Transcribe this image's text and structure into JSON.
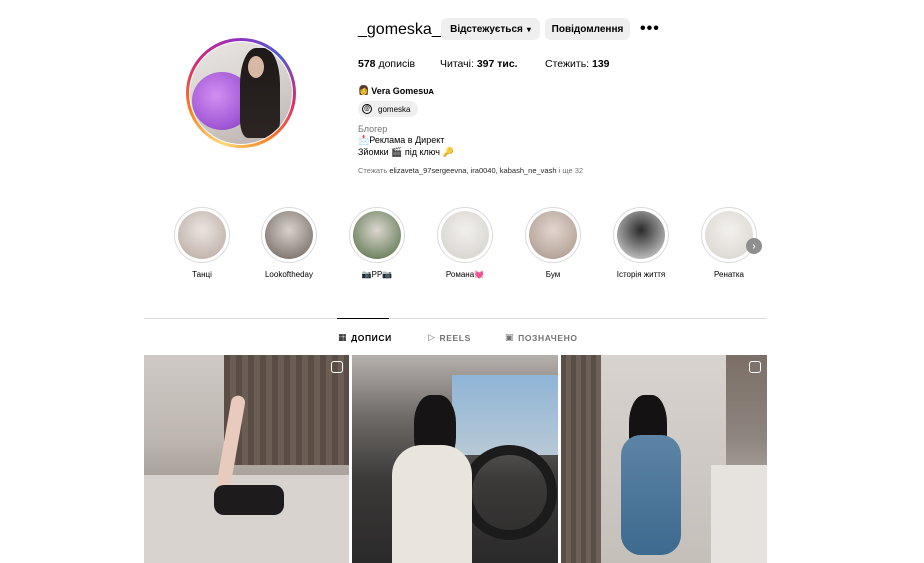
{
  "profile": {
    "username": "_gomeska_",
    "follow_button": "Відстежується",
    "message_button": "Повідомлення",
    "more_label": "•••",
    "stats": {
      "posts_count": "578",
      "posts_label": " дописів",
      "followers_label": "Читачі: ",
      "followers_count": "397 тис.",
      "following_label": "Стежить: ",
      "following_count": "139"
    },
    "display_name": "Vera Gomesᴜᴀ",
    "display_name_emoji": "👩",
    "threads_handle": "gomeska",
    "category": "Блогер",
    "bio_line1": "📩Реклама в Директ",
    "bio_line2": "Зйомки 🎬 під ключ 🔑",
    "followed_by_prefix": "Стежать ",
    "followed_by_names": "elizaveta_97sergeevna, ira0040, kabash_ne_vash",
    "followed_by_suffix": " і ще 32"
  },
  "highlights": [
    {
      "label": "Танці",
      "colors": [
        "#e9e4e0",
        "#b7a79d"
      ]
    },
    {
      "label": "Lookoftheday",
      "colors": [
        "#d8d2cc",
        "#6a5f58"
      ]
    },
    {
      "label": "📷PP📷",
      "colors": [
        "#dcd6d0",
        "#4d6b3f"
      ]
    },
    {
      "label": "Романа💓",
      "colors": [
        "#f1efec",
        "#d4d0cb"
      ]
    },
    {
      "label": "Бум",
      "colors": [
        "#e2d6cf",
        "#a89488"
      ]
    },
    {
      "label": "Історія життя",
      "colors": [
        "#2b2a2a",
        "#e6e6e6"
      ]
    },
    {
      "label": "Ренатка",
      "colors": [
        "#f3f1ee",
        "#d7d2cc"
      ]
    }
  ],
  "tabs": [
    {
      "label": "ДОПИСИ",
      "icon": "grid-icon",
      "active": true
    },
    {
      "label": "REELS",
      "icon": "reels-icon",
      "active": false
    },
    {
      "label": "ПОЗНАЧЕНО",
      "icon": "tagged-icon",
      "active": false
    }
  ]
}
